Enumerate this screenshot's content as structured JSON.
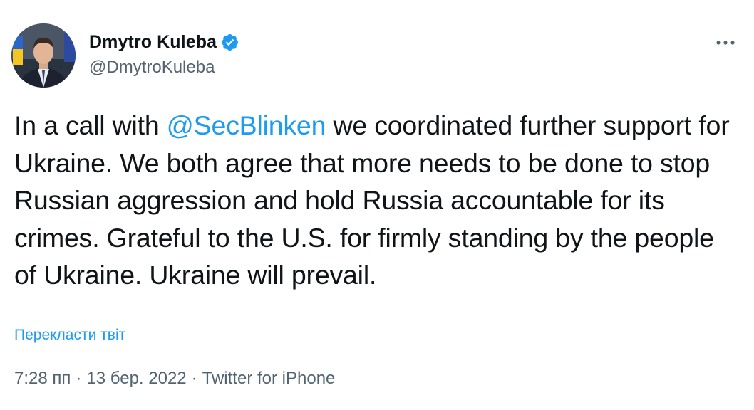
{
  "author": {
    "display_name": "Dmytro Kuleba",
    "handle": "@DmytroKuleba",
    "verified": true,
    "verified_icon": "verified-badge-icon"
  },
  "more_icon": "more-options-icon",
  "tweet": {
    "text_before_mention": "In a call with ",
    "mention": "@SecBlinken",
    "text_after_mention": " we coordinated further support for Ukraine. We both agree that more needs to be done to stop Russian aggression and hold Russia accountable for its crimes. Grateful to the U.S. for firmly standing by the people of Ukraine. Ukraine will prevail."
  },
  "translate_label": "Перекласти твіт",
  "meta": {
    "time": "7:28 пп",
    "separator": "·",
    "date": "13 бер. 2022",
    "source": "Twitter for iPhone"
  },
  "colors": {
    "link": "#1d9bf0",
    "text": "#0f1419",
    "secondary": "#536471"
  }
}
